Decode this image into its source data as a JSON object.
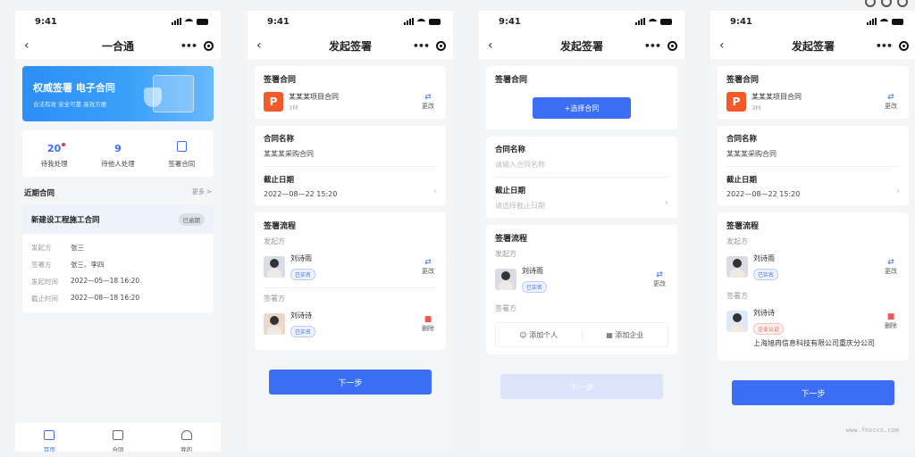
{
  "status_time": "9:41",
  "screen1": {
    "title": "一合通",
    "banner": {
      "title": "权威签署 电子合同",
      "subtitle": "合法有效  安全可靠  高效方便"
    },
    "stats": [
      {
        "num": "20",
        "label": "待我处理"
      },
      {
        "num": "9",
        "label": "待他人处理"
      },
      {
        "label": "签署合同"
      }
    ],
    "recent_title": "近期合同",
    "more": "更多 >",
    "contract": {
      "name": "新建设工程施工合同",
      "status": "已逾期",
      "rows": [
        {
          "k": "发起方",
          "v": "张三"
        },
        {
          "k": "签署方",
          "v": "张三、李四"
        },
        {
          "k": "发起时间",
          "v": "2022—05—18 16:20"
        },
        {
          "k": "截止时间",
          "v": "2022—08—18 16:20"
        }
      ]
    },
    "tabs": [
      "首页",
      "合同",
      "我的"
    ]
  },
  "sign": {
    "title": "发起签署",
    "contract_section": "签署合同",
    "file_name": "某某某项目合同",
    "file_size": "3M",
    "change": "更改",
    "delete": "删除",
    "choose_btn": "+选择合同",
    "name_label": "合同名称",
    "name_value": "某某某采购合同",
    "name_placeholder": "请输入合同名称",
    "deadline_label": "截止日期",
    "deadline_value": "2022—08—22 15:20",
    "deadline_placeholder": "请选择截止日期",
    "flow_title": "签署流程",
    "initiator_label": "发起方",
    "signer_label": "签署方",
    "initiator_name": "刘诗雨",
    "signer_name": "刘诗诗",
    "verified": "已实名",
    "company_badge": "企业认证",
    "company_name": "上海旭冉信息科技有限公司重庆分公司",
    "add_person": "添加个人",
    "add_company": "添加企业",
    "next": "下一步"
  },
  "watermark": "www.fnxccs.com"
}
